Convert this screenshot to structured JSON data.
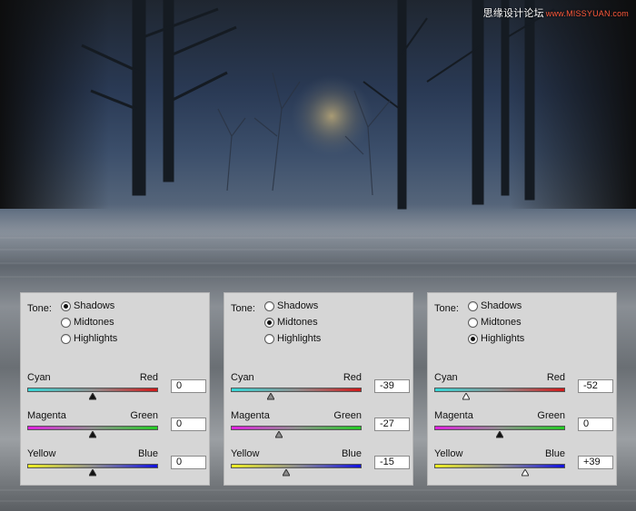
{
  "watermark": {
    "brand": "思缘设计论坛",
    "url": "www.MISSYUAN.com"
  },
  "colors": {
    "cyan": "#35d6d6",
    "red": "#d01818",
    "magenta": "#e020e0",
    "green": "#22cc22",
    "yellow": "#f0f020",
    "blue": "#1010e0",
    "panel_bg": "#d6d6d6"
  },
  "panels": [
    {
      "tone_label": "Tone:",
      "tones": [
        {
          "label": "Shadows",
          "checked": true
        },
        {
          "label": "Midtones",
          "checked": false
        },
        {
          "label": "Highlights",
          "checked": false
        }
      ],
      "sliders": [
        {
          "left": "Cyan",
          "right": "Red",
          "value": "0",
          "num": 0
        },
        {
          "left": "Magenta",
          "right": "Green",
          "value": "0",
          "num": 0
        },
        {
          "left": "Yellow",
          "right": "Blue",
          "value": "0",
          "num": 0
        }
      ]
    },
    {
      "tone_label": "Tone:",
      "tones": [
        {
          "label": "Shadows",
          "checked": false
        },
        {
          "label": "Midtones",
          "checked": true
        },
        {
          "label": "Highlights",
          "checked": false
        }
      ],
      "sliders": [
        {
          "left": "Cyan",
          "right": "Red",
          "value": "-39",
          "num": -39
        },
        {
          "left": "Magenta",
          "right": "Green",
          "value": "-27",
          "num": -27
        },
        {
          "left": "Yellow",
          "right": "Blue",
          "value": "-15",
          "num": -15
        }
      ]
    },
    {
      "tone_label": "Tone:",
      "tones": [
        {
          "label": "Shadows",
          "checked": false
        },
        {
          "label": "Midtones",
          "checked": false
        },
        {
          "label": "Highlights",
          "checked": true
        }
      ],
      "sliders": [
        {
          "left": "Cyan",
          "right": "Red",
          "value": "-52",
          "num": -52
        },
        {
          "left": "Magenta",
          "right": "Green",
          "value": "0",
          "num": 0
        },
        {
          "left": "Yellow",
          "right": "Blue",
          "value": "+39",
          "num": 39
        }
      ]
    }
  ]
}
